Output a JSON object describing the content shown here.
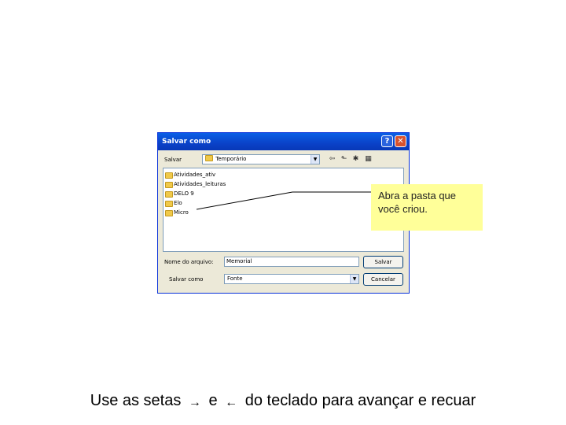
{
  "dialog": {
    "title": "Salvar como",
    "help_glyph": "?",
    "close_glyph": "✕",
    "save_in_label": "Salvar",
    "save_in_value": "Temporário",
    "files": [
      {
        "name": "Atividades_ativ"
      },
      {
        "name": "Atividades_leituras"
      },
      {
        "name": "DELO 9"
      },
      {
        "name": "Elo"
      },
      {
        "name": "Micro"
      }
    ],
    "filename_label": "Nome do arquivo:",
    "filename_value": "Memorial",
    "filetype_label": "Salvar como",
    "filetype_value": "Fonte",
    "save_button": "Salvar",
    "cancel_button": "Cancelar"
  },
  "callout": {
    "text": "Abra a pasta que você criou."
  },
  "caption": {
    "part1": "Use as setas",
    "arrow_right": "→",
    "part2": "e",
    "arrow_left": "←",
    "part3": "do teclado para avançar e recuar"
  }
}
